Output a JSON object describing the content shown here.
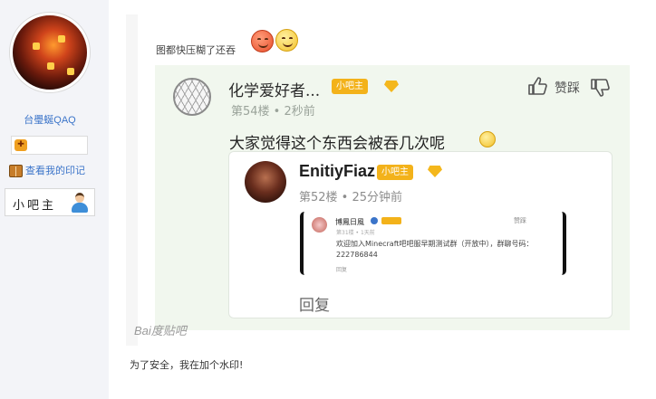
{
  "sidebar": {
    "username": "台璺蜒QAQ",
    "badge_icon": "game-controller-icon",
    "mark_link": "查看我的印记",
    "role_label": "小吧主"
  },
  "post": {
    "text": "图都快压糊了还吞",
    "caption": "为了安全，我在加个水印!",
    "watermark": "Bai度贴吧"
  },
  "outer_reply": {
    "name": "化学爱好者...",
    "tag": "小吧主",
    "floor": "第54楼 • 2秒前",
    "like_label": "赞踩",
    "content": "大家觉得这个东西会被吞几次呢"
  },
  "inner_reply": {
    "name": "EnitiyFiaz",
    "tag": "小吧主",
    "floor": "第52楼 • 25分钟前",
    "reply_label": "回复"
  },
  "nested_reply": {
    "name": "博鳳日風",
    "meta": "第31楼 • 1天前",
    "content": "欢迎加入Minecraft吧吧服早期测试群（开放中），群聊号码：222786844",
    "reply_label": "回复",
    "like_label": "赞踩"
  },
  "colors": {
    "accent": "#3b74c9",
    "tag": "#f3b21a",
    "screenshot_bg": "#f1f7ee"
  }
}
